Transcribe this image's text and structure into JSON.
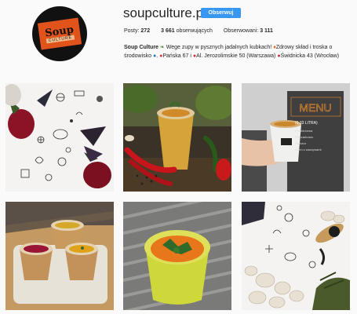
{
  "profile": {
    "username": "soupculture.pl",
    "follow_label": "Obserwuj",
    "posts_label": "Posty:",
    "posts_count": "272",
    "followers_count": "3 661",
    "followers_label": "obserwujących",
    "following_label": "Obserwowani:",
    "following_count": "3 111",
    "bio_name": "Soup Culture",
    "bio_line1": "Wege zupy w pysznych jadalnych kubkach!",
    "bio_line1b": "Zdrowy skład i troska o",
    "bio_line2a": "środowisko",
    "bio_line2b": "Pańska 67 i",
    "bio_line2c": "Al. Jerozolimskie 50 (Warszawa)",
    "bio_line2d": "Świdnicka 43",
    "bio_line3": "(Wrocław)"
  },
  "avatar": {
    "logo_text": "Soup",
    "ribbon_text": "CULTURE"
  },
  "posts": [
    {
      "id": "post-1",
      "subject": "beetroot-pattern"
    },
    {
      "id": "post-2",
      "subject": "soup-cup-with-peppers"
    },
    {
      "id": "post-3",
      "subject": "menu-hand-cup",
      "menu_text": "MENU",
      "menu_price": "(0,33 LITRA)",
      "menu_items": [
        "Pomidorowa",
        "Pieczarkowa",
        "Barszcz",
        "Krem z warzywami"
      ]
    },
    {
      "id": "post-4",
      "subject": "cups-tray"
    },
    {
      "id": "post-5",
      "subject": "green-soup-cup"
    },
    {
      "id": "post-6",
      "subject": "mushroom-pattern"
    }
  ],
  "colors": {
    "follow_button": "#3897f0",
    "avatar_bg": "#111111",
    "avatar_badge": "#e0531b"
  }
}
